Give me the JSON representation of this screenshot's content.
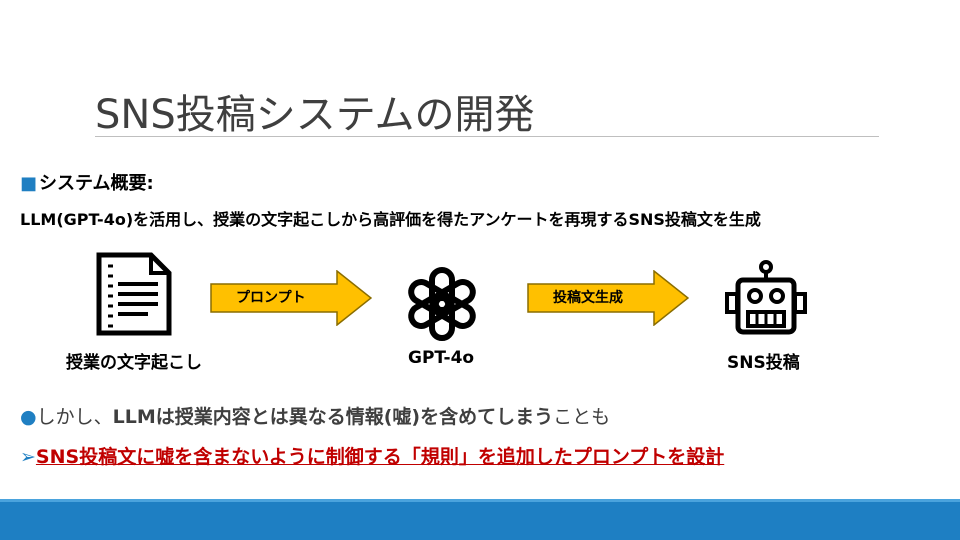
{
  "slide": {
    "title": "SNS投稿システムの開発",
    "section_bullet": "■",
    "section_heading": "システム概要:",
    "summary": "LLM(GPT-4o)を活用し、授業の文字起こしから高評価を得たアンケートを再現するSNS投稿文を生成",
    "flow": {
      "step1_caption": "授業の文字起こし",
      "arrow1_label": "プロンプト",
      "step2_caption": "GPT-4o",
      "arrow2_label": "投稿文生成",
      "step3_caption": "SNS投稿",
      "icons": [
        "document-icon",
        "openai-logo-icon",
        "robot-icon"
      ],
      "arrow_color": "#ffc000"
    },
    "point1": {
      "bullet": "●",
      "text_prefix": "しかし、",
      "text_bold": "LLMは授業内容とは異なる情報(嘘)を含めてしまう",
      "text_suffix": "ことも"
    },
    "point2": {
      "bullet": "➢",
      "text": "SNS投稿文に嘘を含まないように制御する「規則」を追加したプロンプトを設計"
    },
    "colors": {
      "accent": "#1e7fc3",
      "highlight": "#c00000",
      "title": "#3f3f3f"
    }
  }
}
